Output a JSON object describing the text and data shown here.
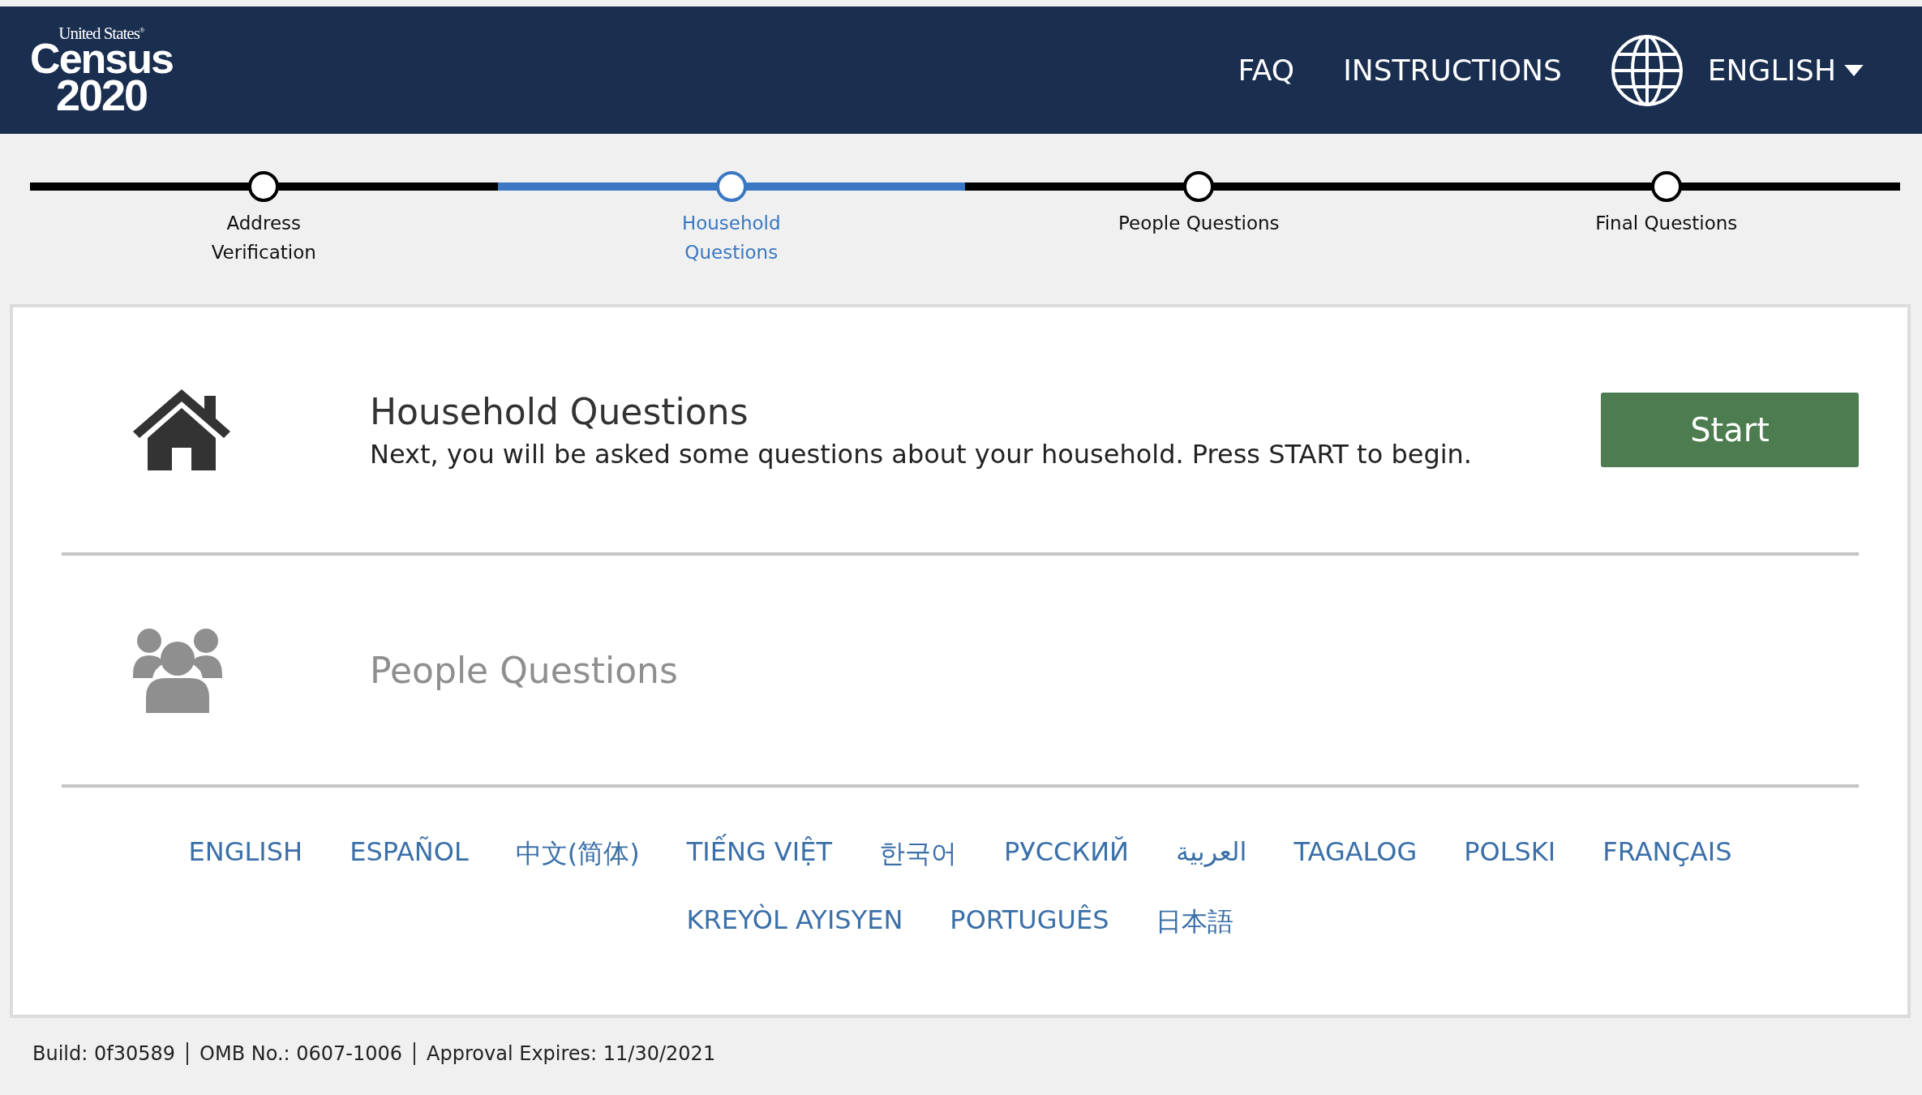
{
  "header": {
    "logo": {
      "line_1": "United States$^{®}$",
      "line_2": "Census",
      "line_3": "2020"
    },
    "nav": [
      "FAQ",
      "INSTRUCTIONS"
    ],
    "language": "ENGLISH"
  },
  "steps": [
    {
      "label": "Address Verification",
      "selected": false
    },
    {
      "label": "Household Questions",
      "selected": true
    },
    {
      "label": "People Questions",
      "selected": false
    },
    {
      "label": "Final Questions",
      "selected": false
    }
  ],
  "sections": [
    {
      "kind": "house",
      "title": "Household Questions",
      "description": "Next, you will be asked some questions about your household. Press START to begin.",
      "button": "Start",
      "disabled": false
    },
    {
      "kind": "people",
      "title": "People Questions",
      "disabled": true
    }
  ],
  "language_rows": [
    [
      "ENGLISH",
      "ESPAÑOL",
      "中文(简体)",
      "TIẾNG VIỆT",
      "한국어",
      "РУССКИЙ",
      "العربية",
      "TAGALOG",
      "POLSKI",
      "FRANÇAIS"
    ],
    [
      "KREYÒL AYISYEN",
      "PORTUGUÊS",
      "日本語"
    ]
  ],
  "footer": [
    "Build: 0f30589",
    "OMB No.: 0607-1006",
    "Approval Expires: 11/30/2021"
  ]
}
